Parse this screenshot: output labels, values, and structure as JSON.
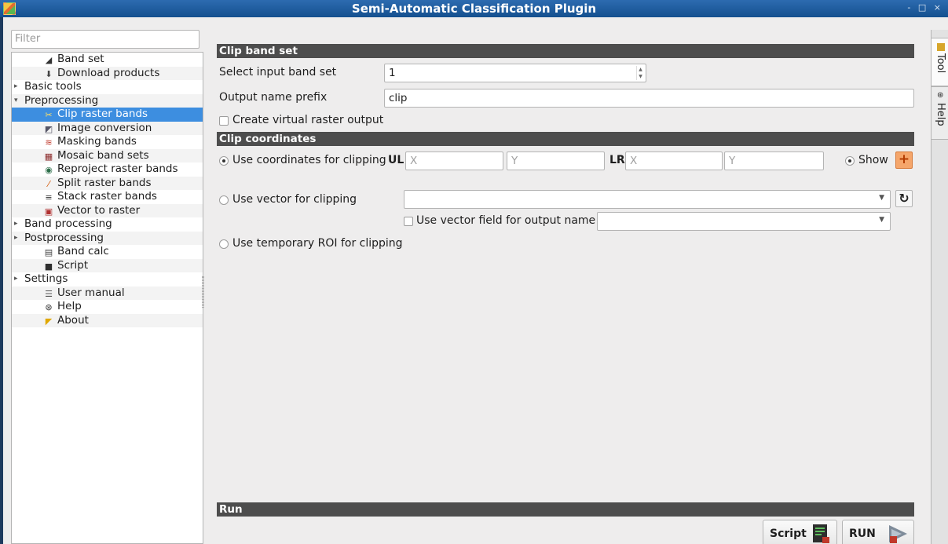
{
  "window": {
    "title": "Semi-Automatic Classification Plugin",
    "controls": "- □ ×"
  },
  "filter": {
    "placeholder": "Filter"
  },
  "tree": [
    {
      "label": "Band set",
      "level": 1,
      "icon": "band-set-icon",
      "icon_glyph": "◢",
      "icon_color": "#333"
    },
    {
      "label": "Download products",
      "level": 1,
      "icon": "download-icon",
      "icon_glyph": "⬇",
      "icon_color": "#444"
    },
    {
      "label": "Basic tools",
      "level": 0,
      "arrow": "▸"
    },
    {
      "label": "Preprocessing",
      "level": 0,
      "arrow": "▾"
    },
    {
      "label": "Clip raster bands",
      "level": 1,
      "selected": true,
      "icon": "scissors-icon",
      "icon_glyph": "✂",
      "icon_color": "#ffe066"
    },
    {
      "label": "Image conversion",
      "level": 1,
      "icon": "image-conversion-icon",
      "icon_glyph": "◩",
      "icon_color": "#556"
    },
    {
      "label": "Masking bands",
      "level": 1,
      "icon": "masking-icon",
      "icon_glyph": "≋",
      "icon_color": "#c0392b"
    },
    {
      "label": "Mosaic band sets",
      "level": 1,
      "icon": "mosaic-icon",
      "icon_glyph": "▦",
      "icon_color": "#8b2a2a"
    },
    {
      "label": "Reproject raster bands",
      "level": 1,
      "icon": "reproject-icon",
      "icon_glyph": "◉",
      "icon_color": "#2c6e49"
    },
    {
      "label": "Split raster bands",
      "level": 1,
      "icon": "split-icon",
      "icon_glyph": "⁄",
      "icon_color": "#d35400"
    },
    {
      "label": "Stack raster bands",
      "level": 1,
      "icon": "stack-icon",
      "icon_glyph": "≡",
      "icon_color": "#333"
    },
    {
      "label": "Vector to raster",
      "level": 1,
      "icon": "vector-to-raster-icon",
      "icon_glyph": "▣",
      "icon_color": "#b03030"
    },
    {
      "label": "Band processing",
      "level": 0,
      "arrow": "▸"
    },
    {
      "label": "Postprocessing",
      "level": 0,
      "arrow": "▸"
    },
    {
      "label": "Band calc",
      "level": 1,
      "icon": "calculator-icon",
      "icon_glyph": "▤",
      "icon_color": "#444"
    },
    {
      "label": "Script",
      "level": 1,
      "icon": "script-icon",
      "icon_glyph": "■",
      "icon_color": "#2f2f2f"
    },
    {
      "label": "Settings",
      "level": 0,
      "arrow": "▸"
    },
    {
      "label": "User manual",
      "level": 1,
      "icon": "manual-icon",
      "icon_glyph": "☰",
      "icon_color": "#555"
    },
    {
      "label": "Help",
      "level": 1,
      "icon": "help-icon",
      "icon_glyph": "⊛",
      "icon_color": "#333"
    },
    {
      "label": "About",
      "level": 1,
      "icon": "about-icon",
      "icon_glyph": "◤",
      "icon_color": "#e0a800"
    }
  ],
  "clip_band_set": {
    "header": "Clip band set",
    "select_label": "Select input band set",
    "select_value": "1",
    "prefix_label": "Output name prefix",
    "prefix_value": "clip",
    "virtual_label": "Create virtual raster output"
  },
  "clip_coordinates": {
    "header": "Clip coordinates",
    "use_coords_label": "Use coordinates for clipping",
    "ul_label": "UL",
    "lr_label": "LR",
    "x_placeholder": "X",
    "y_placeholder": "Y",
    "show_label": "Show",
    "use_vector_label": "Use vector for clipping",
    "vector_field_label": "Use vector field for output name",
    "use_roi_label": "Use temporary ROI for clipping"
  },
  "run": {
    "header": "Run",
    "script_label": "Script",
    "run_label": "RUN"
  },
  "right_tabs": {
    "tool": "Tool",
    "help": "Help"
  },
  "colors": {
    "accent": "#3d8ee0",
    "header": "#4d4d4d",
    "titlebar": "#1e5c9e"
  }
}
